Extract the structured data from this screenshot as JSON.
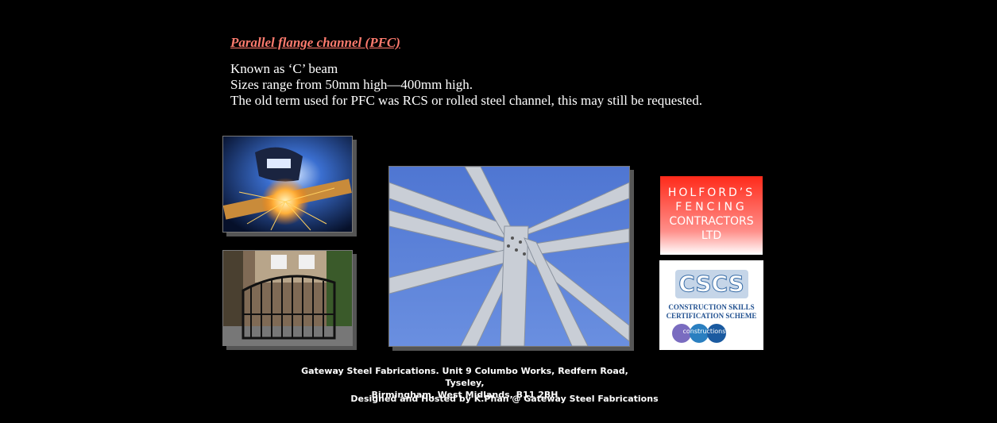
{
  "section": {
    "heading": "Parallel flange channel (PFC)",
    "lines": [
      "Known as ‘C’ beam",
      "Sizes range from 50mm high—400mm high.",
      "The old term used for PFC was RCS or rolled steel channel, this may still be requested."
    ]
  },
  "logos": {
    "holfords": {
      "line1": "HOLFORD’S",
      "line2": "FENCING",
      "line3": "CONTRACTORS",
      "line4": "LTD"
    },
    "cscs": {
      "acronym": "CSCS",
      "line1": "CONSTRUCTION SKILLS",
      "line2": "CERTIFICATION SCHEME",
      "badge": "constructionskills"
    }
  },
  "footer": {
    "address_line1": "Gateway Steel Fabrications. Unit 9 Columbo Works, Redfern Road, Tyseley,",
    "address_line2": "Birmingham, West Midlands, B11 2BH",
    "credit": "Designed and Hosted by K.Phan @ Gateway Steel Fabrications"
  },
  "colors": {
    "background": "#000000",
    "heading": "#ff7b6e",
    "holfords_red": "#ff2a1a",
    "sky_blue": "#5a7fd6"
  }
}
